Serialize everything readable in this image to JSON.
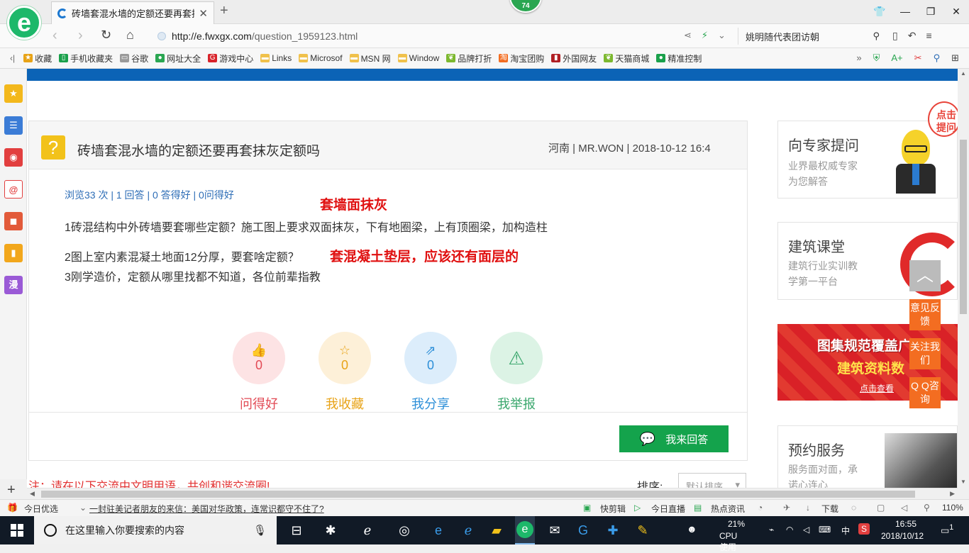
{
  "browser": {
    "tab_title": "砖墙套混水墙的定额还要再套抹灰",
    "badge": "74",
    "url_host": "http://e.fwxgx.com",
    "url_path": "/question_1959123.html",
    "search_text": "姚明随代表团访朝"
  },
  "bookmarks": [
    {
      "label": "收藏",
      "icon": "star-icon",
      "color": "#e8a317"
    },
    {
      "label": "手机收藏夹",
      "icon": "phone-icon",
      "color": "#19a04a"
    },
    {
      "label": "谷歌",
      "icon": "page-icon",
      "color": "#9a9a9a"
    },
    {
      "label": "网址大全",
      "icon": "globe-icon",
      "color": "#2aa651"
    },
    {
      "label": "游戏中心",
      "icon": "game-icon",
      "color": "#d8232a"
    },
    {
      "label": "Links",
      "icon": "folder-icon",
      "color": "#f0c14b"
    },
    {
      "label": "Microsof",
      "icon": "folder-icon",
      "color": "#f0c14b"
    },
    {
      "label": "MSN 网",
      "icon": "folder-icon",
      "color": "#f0c14b"
    },
    {
      "label": "Window",
      "icon": "folder-icon",
      "color": "#f0c14b"
    },
    {
      "label": "品牌打折",
      "icon": "leaf-icon",
      "color": "#7cb82f"
    },
    {
      "label": "淘宝团购",
      "icon": "taobao-icon",
      "color": "#f36d21"
    },
    {
      "label": "外国网友",
      "icon": "flag-icon",
      "color": "#b01e23"
    },
    {
      "label": "天猫商城",
      "icon": "leaf-icon",
      "color": "#7cb82f"
    },
    {
      "label": "精准控制",
      "icon": "chat-icon",
      "color": "#19a04a"
    }
  ],
  "question": {
    "title": "砖墙套混水墙的定额还要再套抹灰定额吗",
    "meta": "河南 | MR.WON | 2018-10-12 16:4",
    "stats": "浏览33 次 | 1 回答 | 0 答得好 | 0问得好",
    "line1": "1砖混结构中外砖墙要套哪些定额？施工图上要求双面抹灰，下有地圈梁，上有顶圈梁，加构造柱",
    "line2": "2图上室内素混凝土地面12分厚，要套啥定额？",
    "line3": "3刚学造价，定额从哪里找都不知道，各位前辈指教",
    "annotation1": "套墙面抹灰",
    "annotation2": "套混凝土垫层，应该还有面层的"
  },
  "actions": [
    {
      "label": "问得好",
      "count": "0",
      "icon": "thumbs-up-icon",
      "color": "#e24a55",
      "bg": "#fde3e4"
    },
    {
      "label": "我收藏",
      "count": "0",
      "icon": "star-outline-icon",
      "color": "#e8a317",
      "bg": "#fdf0d8"
    },
    {
      "label": "我分享",
      "count": "0",
      "icon": "share-icon",
      "color": "#2d8fd8",
      "bg": "#dcedfb"
    },
    {
      "label": "我举报",
      "count": "",
      "icon": "warning-icon",
      "color": "#3aa76d",
      "bg": "#dcf3e5"
    }
  ],
  "answer_button": "我来回答",
  "comment_notice": "注：请在以下交流中文明用语，共创和谐交流圈!",
  "sort": {
    "label": "排序:",
    "value": "默认排序"
  },
  "sidebar_cards": [
    {
      "title": "向专家提问",
      "sub1": "业界最权威专家",
      "sub2": "为您解答"
    },
    {
      "title": "建筑课堂",
      "sub1": "建筑行业实训教",
      "sub2": "学第一平台"
    },
    {
      "title": "预约服务",
      "sub1": "服务面对面，承",
      "sub2": "诺心连心"
    }
  ],
  "promo": {
    "line1": "图集规范覆盖广",
    "line2": "建筑资料数",
    "link": "点击查看"
  },
  "bubble": "点击提问",
  "float_buttons": [
    "意见反馈",
    "关注我们",
    "Q Q咨询"
  ],
  "statusbar": {
    "left": "今日优选",
    "news": "一封驻美记者朋友的来信：美国对华政策，连常识都守不住了?",
    "quickcut": "快剪辑",
    "live": "今日直播",
    "hot": "热点资讯",
    "download": "下载",
    "zoom": "110%"
  },
  "taskbar": {
    "search_placeholder": "在这里输入你要搜索的内容",
    "cpu_percent": "21%",
    "cpu_label": "CPU使用",
    "ime": "中",
    "time": "16:55",
    "date": "2018/10/12",
    "notifications": "1"
  }
}
